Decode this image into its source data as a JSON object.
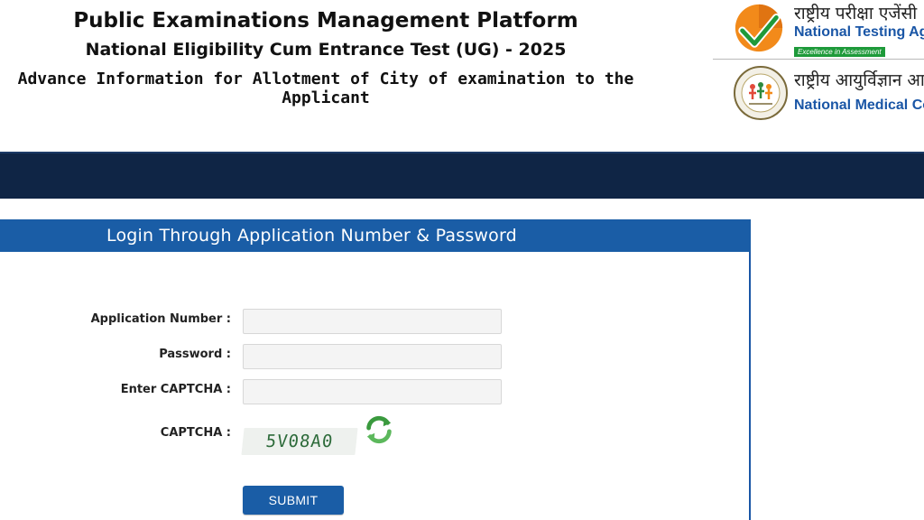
{
  "header": {
    "title": "Public Examinations Management Platform",
    "subtitle": "National Eligibility Cum Entrance Test (UG) - 2025",
    "notice": "Advance Information for Allotment of City of examination to the Applicant"
  },
  "logos": {
    "nta": {
      "hindi": "राष्ट्रीय परीक्षा एजेंसी",
      "english": "National Testing Agency",
      "tagline": "Excellence in Assessment"
    },
    "nmc": {
      "hindi": "राष्ट्रीय आयुर्विज्ञान आयोग",
      "english": "National Medical Commission"
    }
  },
  "login": {
    "heading": "Login Through Application Number & Password",
    "application_number_label": "Application Number :",
    "application_number_value": "",
    "password_label": "Password :",
    "password_value": "",
    "captcha_input_label": "Enter CAPTCHA :",
    "captcha_input_value": "",
    "captcha_label": "CAPTCHA :",
    "captcha_text": "5V08A0",
    "submit_label": "SUBMIT"
  },
  "colors": {
    "primary_blue": "#1a5da6",
    "navbar": "#0f2545",
    "nta_orange": "#f28a1a",
    "nta_green": "#1e9a3a"
  },
  "icons": [
    "nta-emblem-icon",
    "nmc-emblem-icon",
    "refresh-captcha-icon"
  ]
}
